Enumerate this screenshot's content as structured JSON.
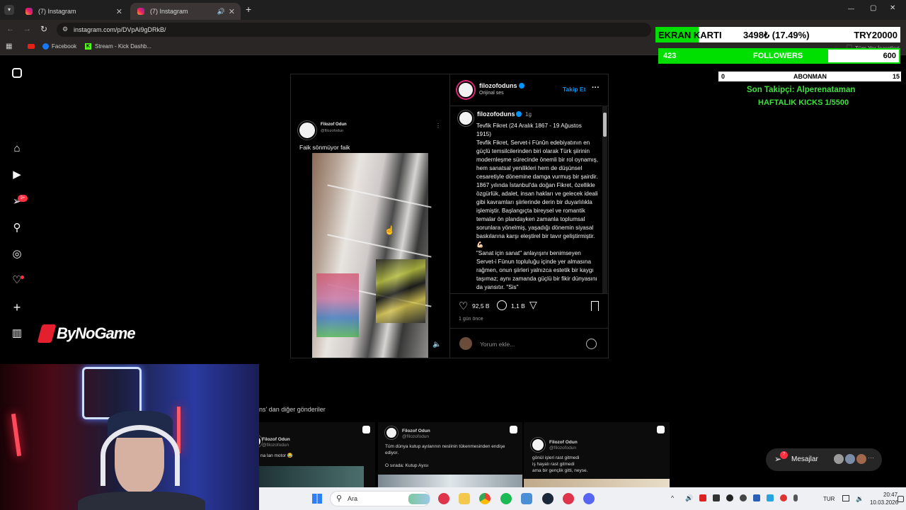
{
  "browser": {
    "tabs": [
      {
        "label": "(7) Instagram",
        "active": false
      },
      {
        "label": "(7) Instagram",
        "active": true
      }
    ],
    "new_tab": "+",
    "url": "instagram.com/p/DVpAi9gDRkB/",
    "bookmarks": [
      {
        "label": "Facebook"
      },
      {
        "label": "Stream - Kick Dashb..."
      }
    ],
    "all_bookmarks": "Tüm Yer İşaretleri",
    "window_controls": [
      "—",
      "▢",
      "✕"
    ]
  },
  "sidebar": {
    "notification_badge": "9+",
    "items": [
      "instagram-icon",
      "home-icon",
      "reels-icon",
      "messages-icon",
      "search-icon",
      "explore-icon",
      "notifications-icon",
      "create-icon",
      "dashboard-icon"
    ]
  },
  "watermark": {
    "text": "ByNoGame"
  },
  "post": {
    "media": {
      "embedded_author": "Filozof Odun",
      "embedded_handle": "@filozofodun",
      "embedded_caption": "Faik sönmüyor faik"
    },
    "header": {
      "username": "filozofoduns",
      "subtitle": "Orijinal ses",
      "follow": "Takip Et",
      "more": "···"
    },
    "caption": {
      "username": "filozofoduns",
      "time": "1g",
      "text": "Tevfik Fikret (24 Aralık 1867 - 19 Ağustos 1915)\nTevfik Fikret, Servet-i Fünûn edebiyatının en güçlü temsilcilerinden biri olarak Türk şiirinin modernleşme sürecinde önemli bir rol oynamış, hem sanatsal yenilikleri hem de düşünsel cesaretiyle dönemine damga vurmuş bir şairdir. 1867 yılında İstanbul'da doğan Fikret, özellikle özgürlük, adalet, insan hakları ve gelecek ideali gibi kavramları şiirlerinde derin bir duyarlılıkla işlemiştir. Başlangıçta bireysel ve romantik temalar ön plandayken zamanla toplumsal sorunlara yönelmiş, yaşadığı dönemin siyasal baskılarına karşı eleştirel bir tavır geliştirmiştir.💪🏻\n\"Sanat için sanat\" anlayışını benimseyen Servet-i Fünun topluluğu içinde yer almasına rağmen, onun şiirleri yalnızca estetik bir kaygı taşımaz; aynı zamanda güçlü bir fikir dünyasını da yansıtır. \"Sis\""
    },
    "likes": "92,5 B",
    "comments": "1,1 B",
    "posted": "1 gün önce",
    "comment_placeholder": "Yorum ekle..."
  },
  "more_posts": {
    "heading": "ns' dan diğer gönderiler",
    "items": [
      {
        "author": "Filozof Odun",
        "handle": "@filozofodun",
        "text": "na lan motor 😂"
      },
      {
        "author": "Filozof Odun",
        "handle": "@filozofodun",
        "text": "Tüm dünya kutup ayılarının neslinin tükenmesinden endişe ediyor.",
        "text2": "O sırada: Kutup Ayısı"
      },
      {
        "author": "Filozof Odun",
        "handle": "@filozofodun",
        "text": "gönül işleri rast gitmedi\niş hayatı rast gitmedi\nama bir gençlik gitti, neyse."
      }
    ]
  },
  "messages": {
    "label": "Mesajlar",
    "badge": "7"
  },
  "stream_overlay": {
    "gpu_label": "EKRAN KARTI",
    "gpu_progress": "3498₺ (17.49%)",
    "gpu_goal": "TRY20000",
    "gpu_fraction": 0.1749,
    "followers_current": "423",
    "followers_label": "FOLLOWERS",
    "followers_goal": "600",
    "followers_fraction": 0.705,
    "sub_current": "0",
    "sub_label": "ABONMAN",
    "sub_goal": "15",
    "last_follower": "Son Takipçi: Alperenataman",
    "weekly_kicks": "HAFTALIK KICKS 1/5500"
  },
  "taskbar": {
    "search": "Ara",
    "lang": "TUR",
    "time": "20:47",
    "date": "10.03.2026"
  },
  "colors": {
    "accent": "#0095f6",
    "overlay_green": "#00e000",
    "overlay_text_green": "#3fe03f"
  }
}
